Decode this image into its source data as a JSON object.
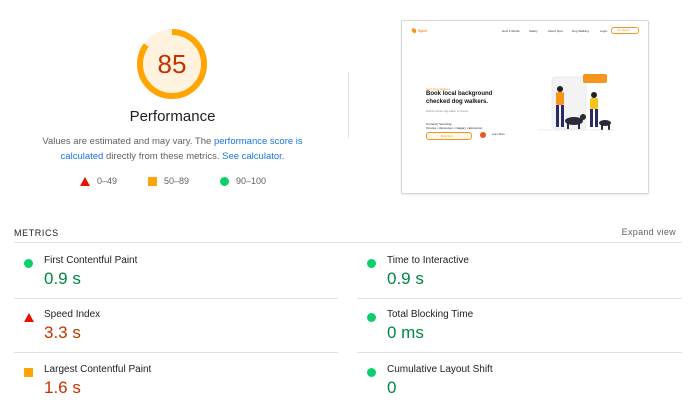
{
  "summary": {
    "score": "85",
    "score_fraction": 0.85,
    "title": "Performance",
    "note_prefix": "Values are estimated and may vary. The ",
    "note_link1": "performance score is calculated",
    "note_middle": " directly from these metrics. ",
    "note_link2": "See calculator."
  },
  "legend": [
    {
      "label": "0–49",
      "shape": "triangle",
      "color": "#eb0f00"
    },
    {
      "label": "50–89",
      "shape": "square",
      "color": "#ffa400"
    },
    {
      "label": "90–100",
      "shape": "circle",
      "color": "#0cce6b"
    }
  ],
  "screenshot": {
    "logo": "Spot",
    "nav": [
      "How It Works",
      "Safety",
      "About Spot",
      "Dog Walking",
      "Login"
    ],
    "nav_button": "Get Started",
    "eyebrow": "Spot Dog Walking",
    "headline_line1": "Book local background",
    "headline_line2": "checked dog walkers.",
    "subtext": "Find the perfect dog walker in minutes.",
    "serving_label": "Currently Servicing:",
    "serving_cities": "Toronto • Vancouver • Calgary • Edmonton",
    "cta": "Book Now",
    "secondary": "Learn More"
  },
  "metrics": {
    "header": "METRICS",
    "expand": "Expand view",
    "items": [
      {
        "label": "First Contentful Paint",
        "value": "0.9 s",
        "status": "pass"
      },
      {
        "label": "Time to Interactive",
        "value": "0.9 s",
        "status": "pass"
      },
      {
        "label": "Speed Index",
        "value": "3.3 s",
        "status": "fail"
      },
      {
        "label": "Total Blocking Time",
        "value": "0 ms",
        "status": "pass"
      },
      {
        "label": "Largest Contentful Paint",
        "value": "1.6 s",
        "status": "average"
      },
      {
        "label": "Cumulative Layout Shift",
        "value": "0",
        "status": "pass"
      }
    ]
  },
  "colors": {
    "fail": "#eb0f00",
    "average": "#ffa400",
    "pass": "#0cce6b",
    "fail_text": "#c33300",
    "pass_text": "#018642",
    "link": "#1a73e8"
  }
}
